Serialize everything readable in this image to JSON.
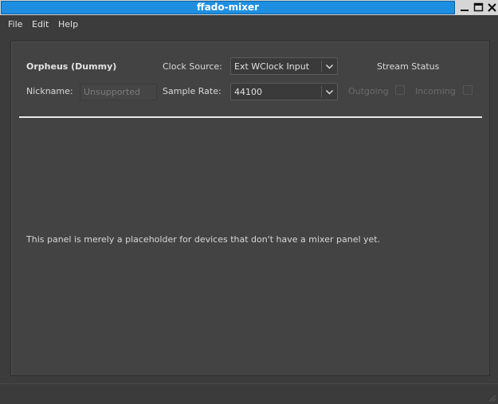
{
  "window": {
    "title": "ffado-mixer"
  },
  "menu": {
    "file": "File",
    "edit": "Edit",
    "help": "Help"
  },
  "device": {
    "name": "Orpheus (Dummy)",
    "nickname_label": "Nickname:",
    "nickname_value": "Unsupported",
    "clock_source_label": "Clock Source:",
    "clock_source_value": "Ext WClock Input",
    "sample_rate_label": "Sample Rate:",
    "sample_rate_value": "44100"
  },
  "stream_status": {
    "title": "Stream Status",
    "outgoing_label": "Outgoing",
    "outgoing_checked": false,
    "incoming_label": "Incoming",
    "incoming_checked": false
  },
  "panel": {
    "placeholder_message": "This panel is merely a placeholder for devices that don't have a mixer panel yet."
  },
  "colors": {
    "titlebar_active": "#1e8fe0",
    "background": "#3c3c3c",
    "panel": "#434343",
    "separator": "#e8e8e8"
  },
  "icons": {
    "minimize": "minimize-icon",
    "maximize": "maximize-icon",
    "close": "close-icon",
    "dropdown": "chevron-down-icon",
    "size_grip": "size-grip-icon"
  }
}
